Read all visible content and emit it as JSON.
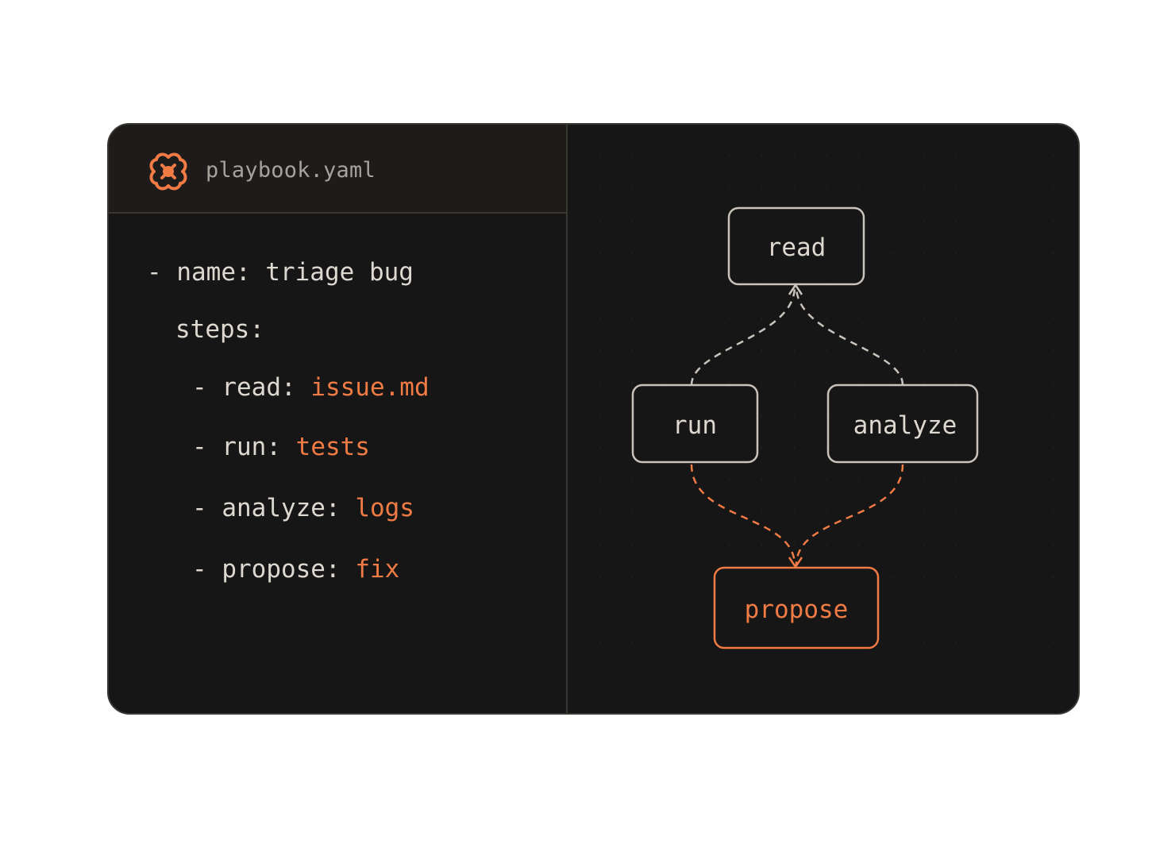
{
  "header": {
    "filename": "playbook.yaml",
    "logo_icon": "playbook-logo-icon"
  },
  "code": {
    "line1": {
      "prefix": "- name: ",
      "value": "triage bug"
    },
    "line2": {
      "prefix": "steps:"
    },
    "step1": {
      "prefix": "- read: ",
      "value": "issue.md"
    },
    "step2": {
      "prefix": "- run: ",
      "value": "tests"
    },
    "step3": {
      "prefix": "- analyze: ",
      "value": "logs"
    },
    "step4": {
      "prefix": "- propose: ",
      "value": "fix"
    }
  },
  "diagram": {
    "nodes": {
      "read": "read",
      "run": "run",
      "analyze": "analyze",
      "propose": "propose"
    },
    "edges": [
      {
        "from": "run",
        "to": "read",
        "style": "dashed-light"
      },
      {
        "from": "analyze",
        "to": "read",
        "style": "dashed-light"
      },
      {
        "from": "run",
        "to": "propose",
        "style": "dashed-accent"
      },
      {
        "from": "analyze",
        "to": "propose",
        "style": "dashed-accent"
      }
    ]
  },
  "colors": {
    "background": "#161616",
    "header": "#1d1c1b",
    "border": "#3a3632",
    "text": "#ddd8d0",
    "muted": "#a7a29c",
    "accent": "#f07b44"
  }
}
